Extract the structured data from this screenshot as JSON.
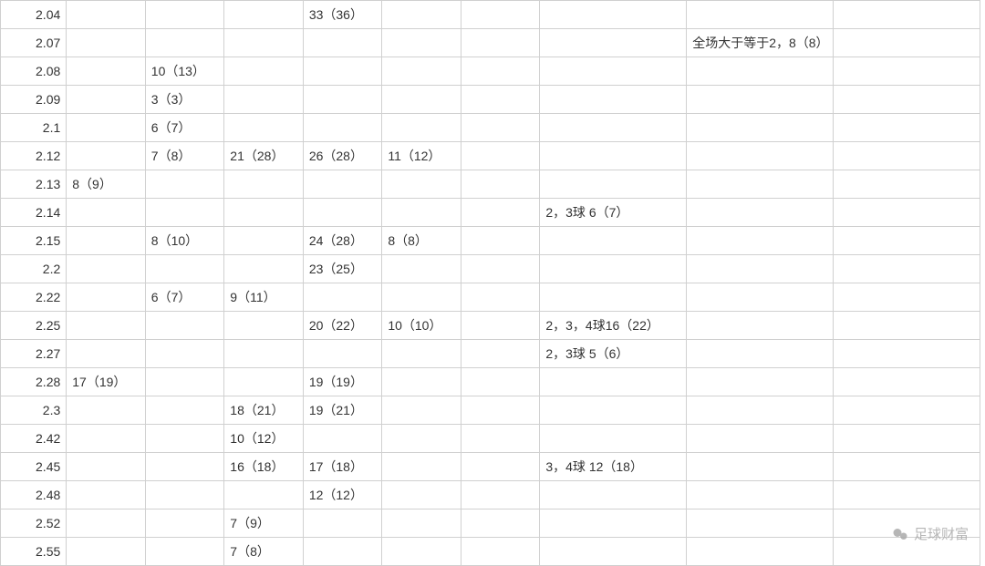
{
  "chart_data": {
    "type": "table",
    "columns": [
      "col1",
      "col2",
      "col3",
      "col4",
      "col5",
      "col6",
      "col7",
      "col8",
      "col9",
      "col10"
    ],
    "rows": [
      {
        "col1": "2.04",
        "col2": "",
        "col3": "",
        "col4": "",
        "col5": "33（36）",
        "col6": "",
        "col7": "",
        "col8": "",
        "col9": "",
        "col10": ""
      },
      {
        "col1": "2.07",
        "col2": "",
        "col3": "",
        "col4": "",
        "col5": "",
        "col6": "",
        "col7": "",
        "col8": "",
        "col9": "全场大于等于2，8（8）",
        "col10": ""
      },
      {
        "col1": "2.08",
        "col2": "",
        "col3": "10（13）",
        "col4": "",
        "col5": "",
        "col6": "",
        "col7": "",
        "col8": "",
        "col9": "",
        "col10": ""
      },
      {
        "col1": "2.09",
        "col2": "",
        "col3": "3（3）",
        "col4": "",
        "col5": "",
        "col6": "",
        "col7": "",
        "col8": "",
        "col9": "",
        "col10": ""
      },
      {
        "col1": "2.1",
        "col2": "",
        "col3": "6（7）",
        "col4": "",
        "col5": "",
        "col6": "",
        "col7": "",
        "col8": "",
        "col9": "",
        "col10": ""
      },
      {
        "col1": "2.12",
        "col2": "",
        "col3": "7（8）",
        "col4": "21（28）",
        "col5": "26（28）",
        "col6": "11（12）",
        "col7": "",
        "col8": "",
        "col9": "",
        "col10": ""
      },
      {
        "col1": "2.13",
        "col2": "8（9）",
        "col3": "",
        "col4": "",
        "col5": "",
        "col6": "",
        "col7": "",
        "col8": "",
        "col9": "",
        "col10": ""
      },
      {
        "col1": "2.14",
        "col2": "",
        "col3": "",
        "col4": "",
        "col5": "",
        "col6": "",
        "col7": "",
        "col8": "2，3球 6（7）",
        "col9": "",
        "col10": ""
      },
      {
        "col1": "2.15",
        "col2": "",
        "col3": "8（10）",
        "col4": "",
        "col5": "24（28）",
        "col6": "8（8）",
        "col7": "",
        "col8": "",
        "col9": "",
        "col10": ""
      },
      {
        "col1": "2.2",
        "col2": "",
        "col3": "",
        "col4": "",
        "col5": "23（25）",
        "col6": "",
        "col7": "",
        "col8": "",
        "col9": "",
        "col10": ""
      },
      {
        "col1": "2.22",
        "col2": "",
        "col3": "6（7）",
        "col4": "9（11）",
        "col5": "",
        "col6": "",
        "col7": "",
        "col8": "",
        "col9": "",
        "col10": ""
      },
      {
        "col1": "2.25",
        "col2": "",
        "col3": "",
        "col4": "",
        "col5": "20（22）",
        "col6": "10（10）",
        "col7": "",
        "col8": "2，3，4球16（22）",
        "col9": "",
        "col10": ""
      },
      {
        "col1": "2.27",
        "col2": "",
        "col3": "",
        "col4": "",
        "col5": "",
        "col6": "",
        "col7": "",
        "col8": "2，3球 5（6）",
        "col9": "",
        "col10": ""
      },
      {
        "col1": "2.28",
        "col2": "17（19）",
        "col3": "",
        "col4": "",
        "col5": "19（19）",
        "col6": "",
        "col7": "",
        "col8": "",
        "col9": "",
        "col10": ""
      },
      {
        "col1": "2.3",
        "col2": "",
        "col3": "",
        "col4": "18（21）",
        "col5": "19（21）",
        "col6": "",
        "col7": "",
        "col8": "",
        "col9": "",
        "col10": ""
      },
      {
        "col1": "2.42",
        "col2": "",
        "col3": "",
        "col4": "10（12）",
        "col5": "",
        "col6": "",
        "col7": "",
        "col8": "",
        "col9": "",
        "col10": ""
      },
      {
        "col1": "2.45",
        "col2": "",
        "col3": "",
        "col4": "16（18）",
        "col5": "17（18）",
        "col6": "",
        "col7": "",
        "col8": "3，4球 12（18）",
        "col9": "",
        "col10": ""
      },
      {
        "col1": "2.48",
        "col2": "",
        "col3": "",
        "col4": "",
        "col5": "12（12）",
        "col6": "",
        "col7": "",
        "col8": "",
        "col9": "",
        "col10": ""
      },
      {
        "col1": "2.52",
        "col2": "",
        "col3": "",
        "col4": "7（9）",
        "col5": "",
        "col6": "",
        "col7": "",
        "col8": "",
        "col9": "",
        "col10": ""
      },
      {
        "col1": "2.55",
        "col2": "",
        "col3": "",
        "col4": "7（8）",
        "col5": "",
        "col6": "",
        "col7": "",
        "col8": "",
        "col9": "",
        "col10": ""
      }
    ]
  },
  "watermark": {
    "text": "足球财富"
  }
}
